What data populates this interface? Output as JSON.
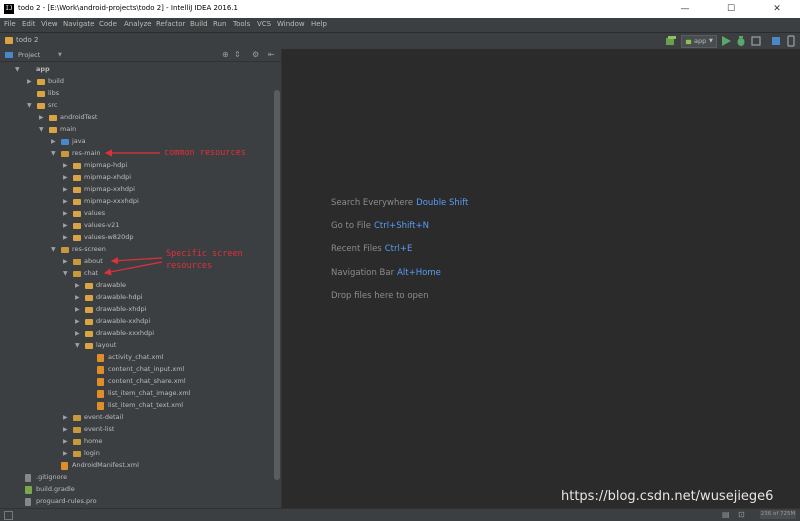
{
  "window": {
    "title": "todo 2 - [E:\\Work\\android-projects\\todo 2] - IntelliJ IDEA 2016.1",
    "app_icon": "IJ",
    "minimize": "—",
    "maximize": "☐",
    "close": "✕"
  },
  "menu": [
    "File",
    "Edit",
    "View",
    "Navigate",
    "Code",
    "Analyze",
    "Refactor",
    "Build",
    "Run",
    "Tools",
    "VCS",
    "Window",
    "Help"
  ],
  "breadcrumb": "todo 2",
  "toolbar": {
    "run_config": "app",
    "run_config_icon": "android-icon"
  },
  "panel": {
    "title": "Project"
  },
  "tree": [
    {
      "label": "app",
      "icon": "module",
      "expanded": true,
      "strong": true
    },
    {
      "label": "build",
      "icon": "folder",
      "expanded": false
    },
    {
      "label": "libs",
      "icon": "folder",
      "leaf": true
    },
    {
      "label": "src",
      "icon": "folder",
      "expanded": true
    },
    {
      "label": "androidTest",
      "icon": "folder",
      "expanded": false
    },
    {
      "label": "main",
      "icon": "folder",
      "expanded": true
    },
    {
      "label": "java",
      "icon": "src",
      "expanded": false
    },
    {
      "label": "res-main",
      "icon": "res",
      "expanded": true
    },
    {
      "label": "mipmap-hdpi",
      "icon": "folder",
      "expanded": false
    },
    {
      "label": "mipmap-xhdpi",
      "icon": "folder",
      "expanded": false
    },
    {
      "label": "mipmap-xxhdpi",
      "icon": "folder",
      "expanded": false
    },
    {
      "label": "mipmap-xxxhdpi",
      "icon": "folder",
      "expanded": false
    },
    {
      "label": "values",
      "icon": "folder",
      "expanded": false
    },
    {
      "label": "values-v21",
      "icon": "folder",
      "expanded": false
    },
    {
      "label": "values-w820dp",
      "icon": "folder",
      "expanded": false
    },
    {
      "label": "res-screen",
      "icon": "res",
      "expanded": true
    },
    {
      "label": "about",
      "icon": "res",
      "expanded": false
    },
    {
      "label": "chat",
      "icon": "res",
      "expanded": true
    },
    {
      "label": "drawable",
      "icon": "folder",
      "expanded": false
    },
    {
      "label": "drawable-hdpi",
      "icon": "folder",
      "expanded": false
    },
    {
      "label": "drawable-xhdpi",
      "icon": "folder",
      "expanded": false
    },
    {
      "label": "drawable-xxhdpi",
      "icon": "folder",
      "expanded": false
    },
    {
      "label": "drawable-xxxhdpi",
      "icon": "folder",
      "expanded": false
    },
    {
      "label": "layout",
      "icon": "folder",
      "expanded": true
    },
    {
      "label": "activity_chat.xml",
      "icon": "xml",
      "leaf": true
    },
    {
      "label": "content_chat_input.xml",
      "icon": "xml",
      "leaf": true
    },
    {
      "label": "content_chat_share.xml",
      "icon": "xml",
      "leaf": true
    },
    {
      "label": "list_item_chat_image.xml",
      "icon": "xml",
      "leaf": true
    },
    {
      "label": "list_item_chat_text.xml",
      "icon": "xml",
      "leaf": true
    },
    {
      "label": "event-detail",
      "icon": "res",
      "expanded": false
    },
    {
      "label": "event-list",
      "icon": "res",
      "expanded": false
    },
    {
      "label": "home",
      "icon": "res",
      "expanded": false
    },
    {
      "label": "login",
      "icon": "res",
      "expanded": false
    },
    {
      "label": "AndroidManifest.xml",
      "icon": "manifest",
      "leaf": true
    },
    {
      "label": ".gitignore",
      "icon": "file",
      "leaf": true
    },
    {
      "label": "build.gradle",
      "icon": "gradle",
      "leaf": true
    },
    {
      "label": "proguard-rules.pro",
      "icon": "file",
      "leaf": true
    }
  ],
  "editor_hints": [
    {
      "text": "Search Everywhere",
      "key": "Double Shift"
    },
    {
      "text": "Go to File",
      "key": "Ctrl+Shift+N"
    },
    {
      "text": "Recent Files",
      "key": "Ctrl+E"
    },
    {
      "text": "Navigation Bar",
      "key": "Alt+Home"
    },
    {
      "text": "Drop files here to open",
      "key": ""
    }
  ],
  "annotations": {
    "common": "common resources",
    "specific_line1": "Specific screen",
    "specific_line2": "resources"
  },
  "status": {
    "memory": "236 of 725M"
  },
  "watermark": "https://blog.csdn.net/wusejiege6",
  "colors": {
    "annotation": "#e0303a",
    "shortcut": "#589df6",
    "folder": "#d9a441"
  }
}
